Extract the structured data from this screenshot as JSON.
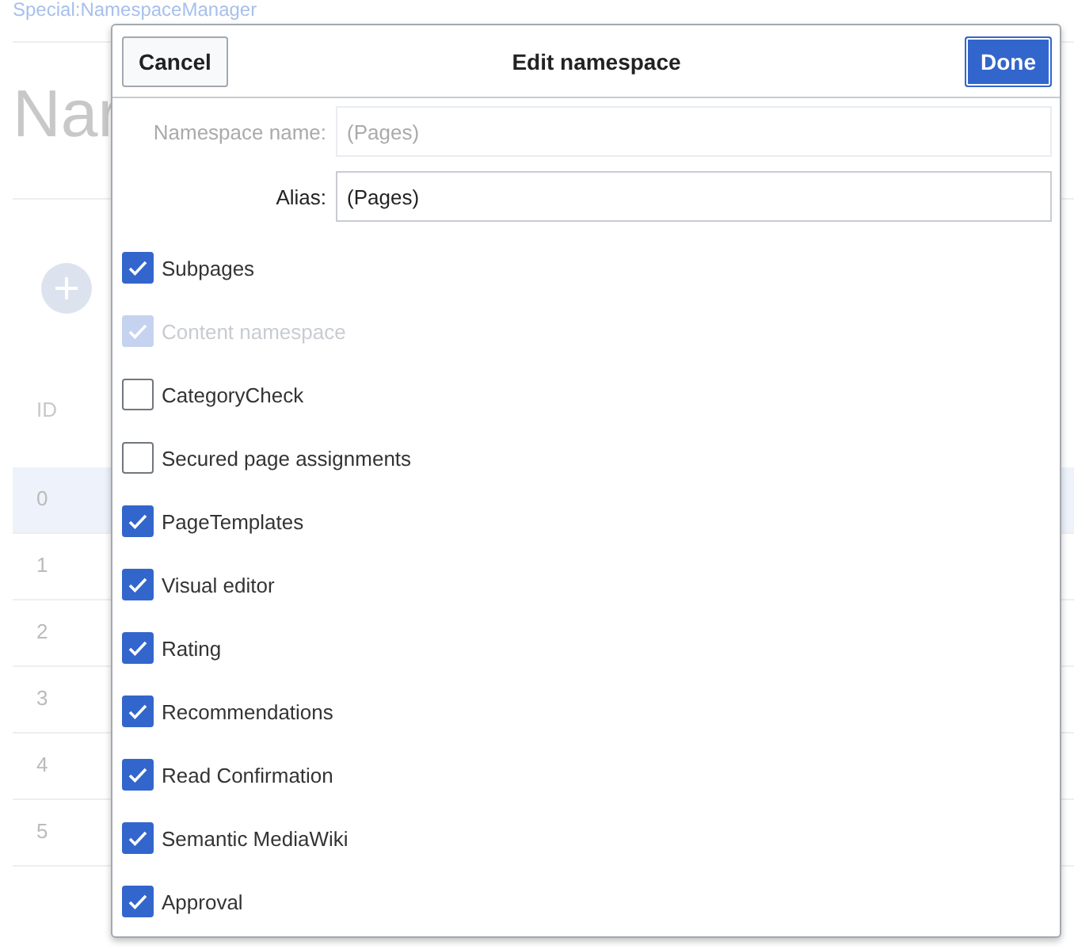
{
  "page": {
    "breadcrumb": "Special:NamespaceManager",
    "heading": "Nar",
    "table": {
      "header": "ID",
      "rows": [
        {
          "id": "0",
          "selected": true
        },
        {
          "id": "1",
          "selected": false
        },
        {
          "id": "2",
          "selected": false
        },
        {
          "id": "3",
          "selected": false
        },
        {
          "id": "4",
          "selected": false
        },
        {
          "id": "5",
          "selected": false
        }
      ]
    }
  },
  "dialog": {
    "title": "Edit namespace",
    "cancel": "Cancel",
    "done": "Done",
    "fields": [
      {
        "label": "Namespace name:",
        "value": "(Pages)",
        "disabled": true
      },
      {
        "label": "Alias:",
        "value": "(Pages)",
        "disabled": false
      }
    ],
    "options": [
      {
        "label": "Subpages",
        "checked": true,
        "disabled": false
      },
      {
        "label": "Content namespace",
        "checked": true,
        "disabled": true
      },
      {
        "label": "CategoryCheck",
        "checked": false,
        "disabled": false
      },
      {
        "label": "Secured page assignments",
        "checked": false,
        "disabled": false
      },
      {
        "label": "PageTemplates",
        "checked": true,
        "disabled": false
      },
      {
        "label": "Visual editor",
        "checked": true,
        "disabled": false
      },
      {
        "label": "Rating",
        "checked": true,
        "disabled": false
      },
      {
        "label": "Recommendations",
        "checked": true,
        "disabled": false
      },
      {
        "label": "Read Confirmation",
        "checked": true,
        "disabled": false
      },
      {
        "label": "Semantic MediaWiki",
        "checked": true,
        "disabled": false
      },
      {
        "label": "Approval",
        "checked": true,
        "disabled": false
      }
    ]
  }
}
